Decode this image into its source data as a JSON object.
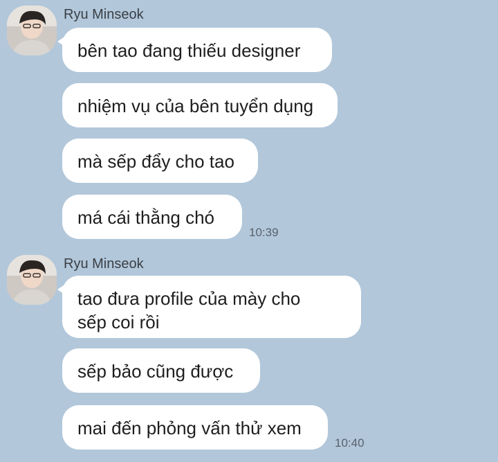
{
  "groups": [
    {
      "sender": "Ryu Minseok",
      "avatar_icon": "profile-photo",
      "messages": [
        "bên tao đang thiếu designer",
        "nhiệm vụ của bên tuyển dụng",
        "mà sếp đẩy cho tao",
        "má cái thằng chó"
      ],
      "time": "10:39"
    },
    {
      "sender": "Ryu Minseok",
      "avatar_icon": "profile-photo",
      "messages": [
        "tao đưa profile của mày cho\nsếp coi rồi",
        "sếp bảo cũng được",
        "mai đến phỏng vấn thử xem"
      ],
      "time": "10:40"
    }
  ]
}
